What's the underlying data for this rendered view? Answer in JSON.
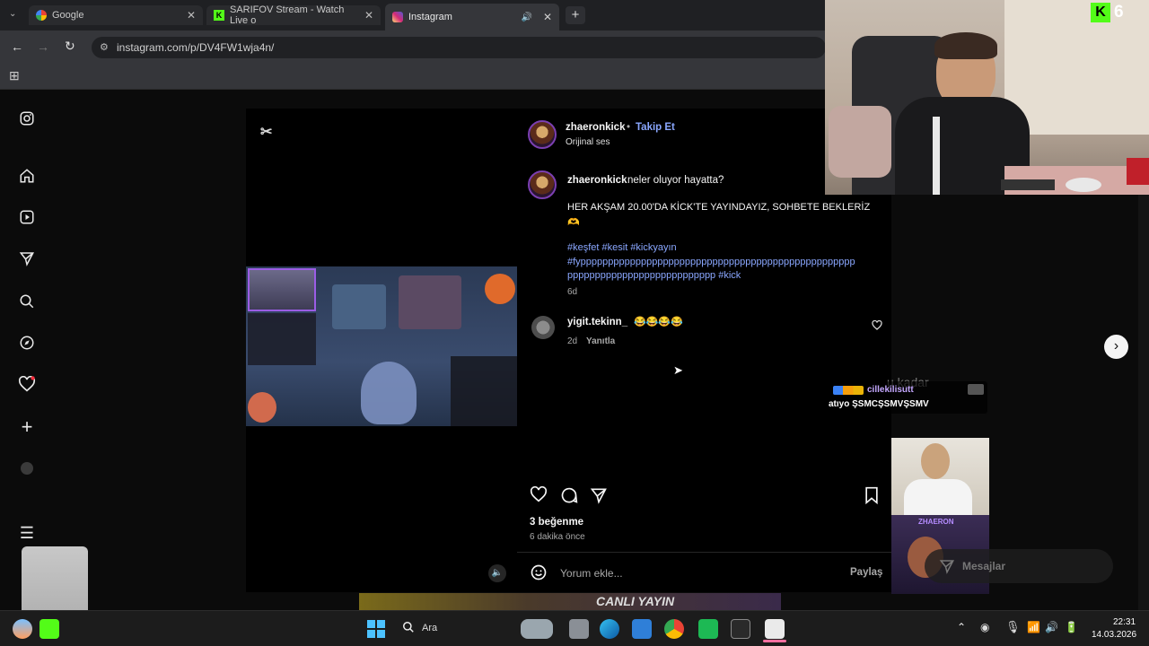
{
  "browser": {
    "tabs": [
      {
        "label": "Google",
        "icon": "google-icon"
      },
      {
        "label": "SARIFOV Stream - Watch Live o",
        "icon": "kick-icon"
      },
      {
        "label": "Instagram",
        "icon": "instagram-icon"
      }
    ],
    "url": "instagram.com/p/DV4FW1wja4n/"
  },
  "post": {
    "author": "zhaeronkick",
    "follow_label": "Takip Et",
    "audio": "Orijinal ses",
    "caption_user": "zhaeronkick",
    "caption_text": "neler oluyor hayatta?",
    "caption_line2": "HER AKŞAM 20.00'DA KİCK'TE YAYINDAYIZ, SOHBETE BEKLERİZ",
    "caption_emoji": "🫶",
    "hashtags1": "#keşfet #kesit #kickyayın",
    "hashtags2": "#fypppppppppppppppppppppppppppppppppppppppppppppppppp",
    "hashtags3": "ppppppppppppppppppppppppppp #kick",
    "caption_time": "6d",
    "comment": {
      "user": "yigit.tekinn_",
      "text": "😂😂😂😂",
      "time": "2d",
      "reply_label": "Yanıtla"
    },
    "likes": "3 beğenme",
    "posted_time": "6 dakika önce",
    "comment_placeholder": "Yorum ekle...",
    "share_label": "Paylaş"
  },
  "overlay": {
    "kick_count": "6",
    "chat_user": "cillekilisutt",
    "chat_text": "atıyo ŞSMCŞSMVŞSMV",
    "ghost_text": "u kadar",
    "messages_label": "Mesajlar",
    "banner_text": "CANLI YAYIN",
    "webcam_name": "ZHAERON"
  },
  "taskbar": {
    "search_label": "Ara",
    "time": "22:31",
    "date": "14.03.2026"
  },
  "colors": {
    "accent_blue": "#8aa7ff",
    "kick_green": "#53fc18",
    "background": "#000000"
  }
}
